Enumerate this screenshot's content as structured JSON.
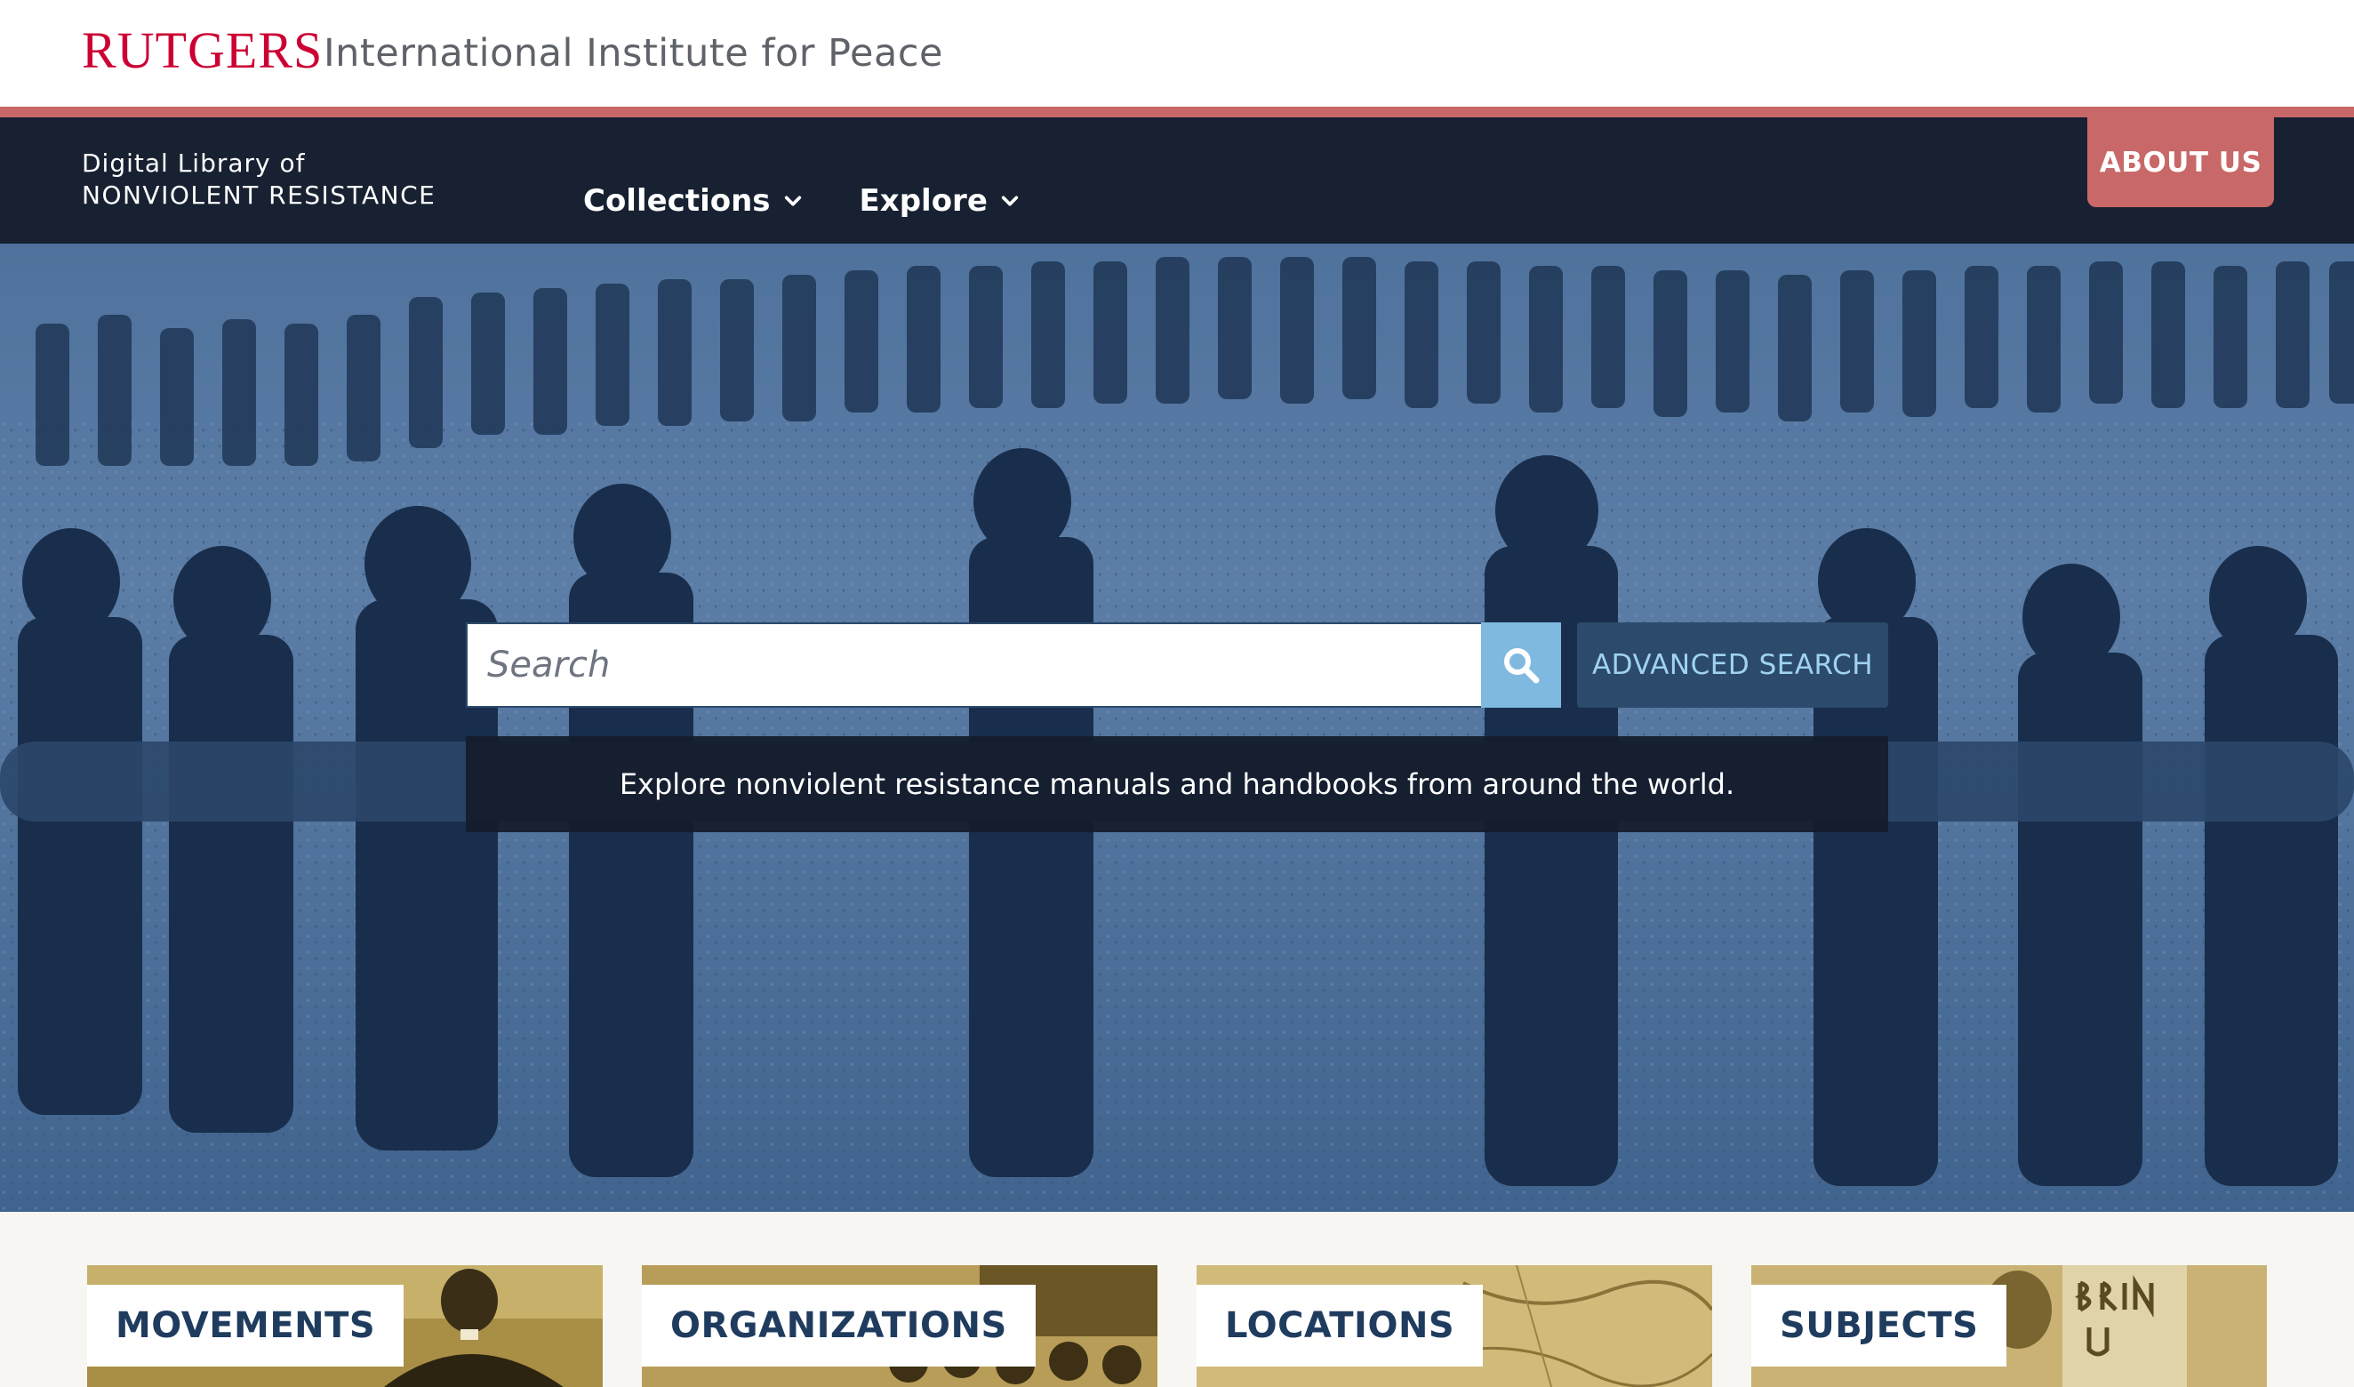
{
  "brand": {
    "university": "RUTGERS",
    "institute": "International Institute for Peace"
  },
  "navbar": {
    "site_title_line1": "Digital Library of",
    "site_title_line2": "NONVIOLENT RESISTANCE",
    "menu": [
      {
        "label": "Collections",
        "icon": "chevron-down-icon"
      },
      {
        "label": "Explore",
        "icon": "chevron-down-icon"
      }
    ],
    "about_label": "ABOUT US"
  },
  "hero": {
    "search_placeholder": "Search",
    "search_value": "",
    "search_icon": "magnifier-icon",
    "advanced_search_label": "ADVANCED SEARCH",
    "tagline": "Explore nonviolent resistance manuals and handbooks from around the world."
  },
  "categories": [
    {
      "label": "MOVEMENTS"
    },
    {
      "label": "ORGANIZATIONS"
    },
    {
      "label": "LOCATIONS"
    },
    {
      "label": "SUBJECTS"
    }
  ],
  "colors": {
    "brand_red": "#cc0033",
    "accent": "#c86868",
    "navbar": "#172131",
    "search_button": "#7fb9e0",
    "advanced_button": "#2c4a6b",
    "card_label_text": "#1f3c5f"
  }
}
